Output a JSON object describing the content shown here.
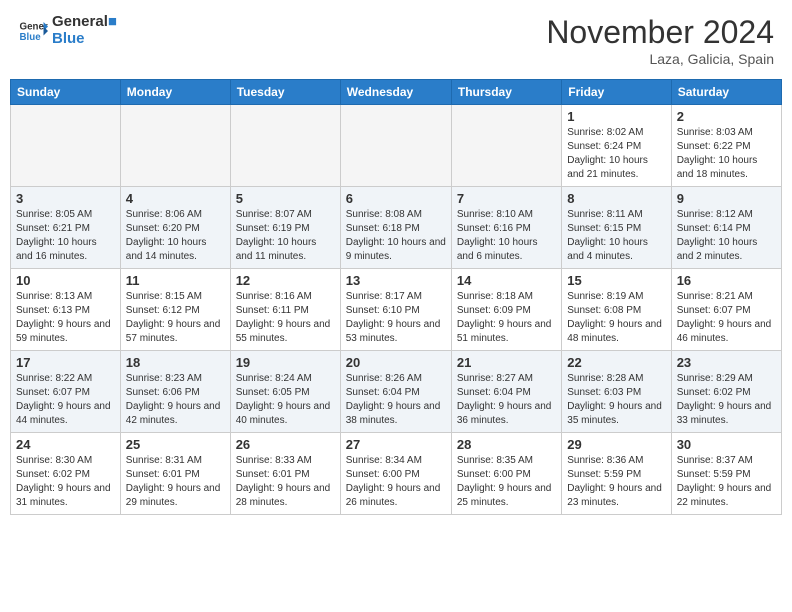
{
  "header": {
    "logo_line1": "General",
    "logo_line2": "Blue",
    "month_title": "November 2024",
    "location": "Laza, Galicia, Spain"
  },
  "days_of_week": [
    "Sunday",
    "Monday",
    "Tuesday",
    "Wednesday",
    "Thursday",
    "Friday",
    "Saturday"
  ],
  "weeks": [
    [
      {
        "day": "",
        "info": ""
      },
      {
        "day": "",
        "info": ""
      },
      {
        "day": "",
        "info": ""
      },
      {
        "day": "",
        "info": ""
      },
      {
        "day": "",
        "info": ""
      },
      {
        "day": "1",
        "info": "Sunrise: 8:02 AM\nSunset: 6:24 PM\nDaylight: 10 hours and 21 minutes."
      },
      {
        "day": "2",
        "info": "Sunrise: 8:03 AM\nSunset: 6:22 PM\nDaylight: 10 hours and 18 minutes."
      }
    ],
    [
      {
        "day": "3",
        "info": "Sunrise: 8:05 AM\nSunset: 6:21 PM\nDaylight: 10 hours and 16 minutes."
      },
      {
        "day": "4",
        "info": "Sunrise: 8:06 AM\nSunset: 6:20 PM\nDaylight: 10 hours and 14 minutes."
      },
      {
        "day": "5",
        "info": "Sunrise: 8:07 AM\nSunset: 6:19 PM\nDaylight: 10 hours and 11 minutes."
      },
      {
        "day": "6",
        "info": "Sunrise: 8:08 AM\nSunset: 6:18 PM\nDaylight: 10 hours and 9 minutes."
      },
      {
        "day": "7",
        "info": "Sunrise: 8:10 AM\nSunset: 6:16 PM\nDaylight: 10 hours and 6 minutes."
      },
      {
        "day": "8",
        "info": "Sunrise: 8:11 AM\nSunset: 6:15 PM\nDaylight: 10 hours and 4 minutes."
      },
      {
        "day": "9",
        "info": "Sunrise: 8:12 AM\nSunset: 6:14 PM\nDaylight: 10 hours and 2 minutes."
      }
    ],
    [
      {
        "day": "10",
        "info": "Sunrise: 8:13 AM\nSunset: 6:13 PM\nDaylight: 9 hours and 59 minutes."
      },
      {
        "day": "11",
        "info": "Sunrise: 8:15 AM\nSunset: 6:12 PM\nDaylight: 9 hours and 57 minutes."
      },
      {
        "day": "12",
        "info": "Sunrise: 8:16 AM\nSunset: 6:11 PM\nDaylight: 9 hours and 55 minutes."
      },
      {
        "day": "13",
        "info": "Sunrise: 8:17 AM\nSunset: 6:10 PM\nDaylight: 9 hours and 53 minutes."
      },
      {
        "day": "14",
        "info": "Sunrise: 8:18 AM\nSunset: 6:09 PM\nDaylight: 9 hours and 51 minutes."
      },
      {
        "day": "15",
        "info": "Sunrise: 8:19 AM\nSunset: 6:08 PM\nDaylight: 9 hours and 48 minutes."
      },
      {
        "day": "16",
        "info": "Sunrise: 8:21 AM\nSunset: 6:07 PM\nDaylight: 9 hours and 46 minutes."
      }
    ],
    [
      {
        "day": "17",
        "info": "Sunrise: 8:22 AM\nSunset: 6:07 PM\nDaylight: 9 hours and 44 minutes."
      },
      {
        "day": "18",
        "info": "Sunrise: 8:23 AM\nSunset: 6:06 PM\nDaylight: 9 hours and 42 minutes."
      },
      {
        "day": "19",
        "info": "Sunrise: 8:24 AM\nSunset: 6:05 PM\nDaylight: 9 hours and 40 minutes."
      },
      {
        "day": "20",
        "info": "Sunrise: 8:26 AM\nSunset: 6:04 PM\nDaylight: 9 hours and 38 minutes."
      },
      {
        "day": "21",
        "info": "Sunrise: 8:27 AM\nSunset: 6:04 PM\nDaylight: 9 hours and 36 minutes."
      },
      {
        "day": "22",
        "info": "Sunrise: 8:28 AM\nSunset: 6:03 PM\nDaylight: 9 hours and 35 minutes."
      },
      {
        "day": "23",
        "info": "Sunrise: 8:29 AM\nSunset: 6:02 PM\nDaylight: 9 hours and 33 minutes."
      }
    ],
    [
      {
        "day": "24",
        "info": "Sunrise: 8:30 AM\nSunset: 6:02 PM\nDaylight: 9 hours and 31 minutes."
      },
      {
        "day": "25",
        "info": "Sunrise: 8:31 AM\nSunset: 6:01 PM\nDaylight: 9 hours and 29 minutes."
      },
      {
        "day": "26",
        "info": "Sunrise: 8:33 AM\nSunset: 6:01 PM\nDaylight: 9 hours and 28 minutes."
      },
      {
        "day": "27",
        "info": "Sunrise: 8:34 AM\nSunset: 6:00 PM\nDaylight: 9 hours and 26 minutes."
      },
      {
        "day": "28",
        "info": "Sunrise: 8:35 AM\nSunset: 6:00 PM\nDaylight: 9 hours and 25 minutes."
      },
      {
        "day": "29",
        "info": "Sunrise: 8:36 AM\nSunset: 5:59 PM\nDaylight: 9 hours and 23 minutes."
      },
      {
        "day": "30",
        "info": "Sunrise: 8:37 AM\nSunset: 5:59 PM\nDaylight: 9 hours and 22 minutes."
      }
    ]
  ]
}
